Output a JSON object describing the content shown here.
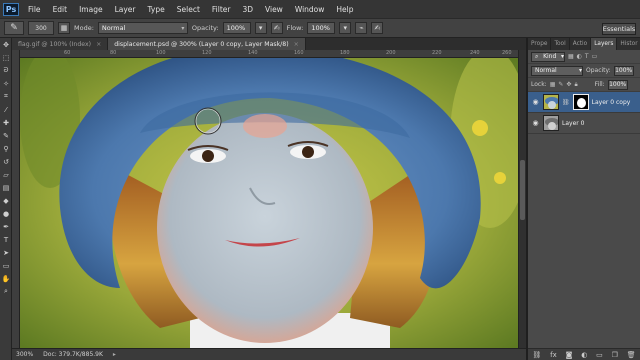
{
  "app": {
    "logo": "Ps"
  },
  "menu": [
    "File",
    "Edit",
    "Image",
    "Layer",
    "Type",
    "Select",
    "Filter",
    "3D",
    "View",
    "Window",
    "Help"
  ],
  "options": {
    "brush_size": "300",
    "mode_label": "Mode:",
    "mode_value": "Normal",
    "opacity_label": "Opacity:",
    "opacity_value": "100%",
    "flow_label": "Flow:",
    "flow_value": "100%",
    "workspace": "Essentials"
  },
  "tabs": [
    {
      "label": "flag.gif @ 100% (Index)"
    },
    {
      "label": "displacement.psd @ 300% (Layer 0 copy, Layer Mask/8)"
    }
  ],
  "ruler_ticks": [
    "60",
    "80",
    "100",
    "120",
    "140",
    "160",
    "180",
    "200",
    "220",
    "240",
    "260"
  ],
  "status": {
    "zoom": "300%",
    "doc": "Doc: 379.7K/885.9K"
  },
  "panel": {
    "tabs": [
      "Prope",
      "Tool",
      "Actio",
      "Layers",
      "Histor"
    ],
    "filter_kind": "Kind",
    "blend_mode": "Normal",
    "opacity_label": "Opacity:",
    "opacity_value": "100%",
    "lock_label": "Lock:",
    "fill_label": "Fill:",
    "fill_value": "100%",
    "layers": [
      {
        "name": "Layer 0 copy"
      },
      {
        "name": "Layer 0"
      }
    ]
  },
  "colors": {
    "accent": "#3a5f8c",
    "ui_bg": "#2b2b2b"
  }
}
